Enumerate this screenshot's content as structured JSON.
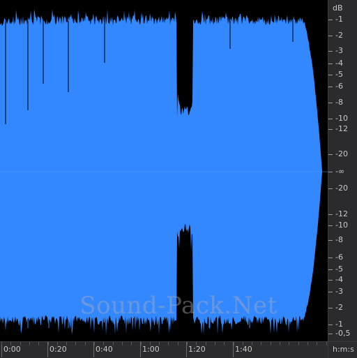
{
  "watermark": "Sound-Pack.Net",
  "colors": {
    "waveform": "#3388ff",
    "background": "#000000",
    "panel": "#2b2b2d",
    "label": "#c9c9c9"
  },
  "db_scale": {
    "unit": "dB",
    "labels": [
      "-1",
      "-2",
      "-3",
      "-4",
      "-5",
      "-6",
      "-8",
      "-10",
      "-12",
      "-20",
      "-∞",
      "-20",
      "-12",
      "-10",
      "-8",
      "-6",
      "-5",
      "-4",
      "-3",
      "-2",
      "-1",
      "-0,5"
    ]
  },
  "time_axis": {
    "unit": "h:m:s",
    "labels": [
      "0:00",
      "0:20",
      "0:40",
      "1:00",
      "1:20",
      "1:40"
    ]
  }
}
